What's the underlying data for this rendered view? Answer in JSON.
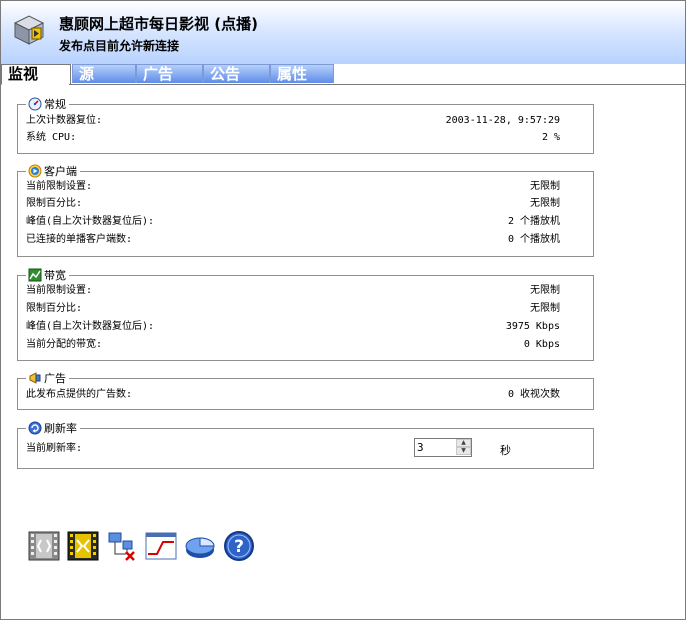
{
  "header": {
    "title": "惠顾网上超市每日影视 (点播)",
    "subtitle": "发布点目前允许新连接",
    "logo_icon": "server-icon"
  },
  "tabs": [
    {
      "label": "监视",
      "active": true
    },
    {
      "label": "源",
      "active": false
    },
    {
      "label": "广告",
      "active": false
    },
    {
      "label": "公告",
      "active": false
    },
    {
      "label": "属性",
      "active": false
    }
  ],
  "general": {
    "title": "常规",
    "icon": "gauge-icon",
    "rows": [
      {
        "label": "上次计数器复位:",
        "value": "2003-11-28, 9:57:29"
      },
      {
        "label": "系统 CPU:",
        "value": "2 %"
      }
    ]
  },
  "clients": {
    "title": "客户端",
    "icon": "play-client-icon",
    "rows": [
      {
        "label": "当前限制设置:",
        "value": "无限制"
      },
      {
        "label": "限制百分比:",
        "value": "无限制"
      },
      {
        "label": "峰值(自上次计数器复位后):",
        "value": "2 个播放机"
      },
      {
        "label": "已连接的单播客户端数:",
        "value": "0 个播放机"
      }
    ]
  },
  "bandwidth": {
    "title": "带宽",
    "icon": "bandwidth-icon",
    "rows": [
      {
        "label": "当前限制设置:",
        "value": "无限制"
      },
      {
        "label": "限制百分比:",
        "value": "无限制"
      },
      {
        "label": "峰值(自上次计数器复位后):",
        "value": "3975 Kbps"
      },
      {
        "label": "当前分配的带宽:",
        "value": "0 Kbps"
      }
    ]
  },
  "ads": {
    "title": "广告",
    "icon": "ad-icon",
    "rows": [
      {
        "label": "此发布点提供的广告数:",
        "value": "0 收视次数"
      }
    ]
  },
  "refresh": {
    "title": "刷新率",
    "icon": "refresh-icon",
    "label": "当前刷新率:",
    "value": "3",
    "unit": "秒"
  },
  "toolbar": [
    {
      "name": "stop-publishing-button",
      "icon": "film-strip-icon"
    },
    {
      "name": "start-publishing-button",
      "icon": "film-strip-active-icon"
    },
    {
      "name": "disconnect-clients-button",
      "icon": "network-disconnect-icon"
    },
    {
      "name": "performance-graph-button",
      "icon": "graph-icon"
    },
    {
      "name": "reset-counters-button",
      "icon": "pie-chart-icon"
    },
    {
      "name": "help-button",
      "icon": "help-icon"
    }
  ]
}
